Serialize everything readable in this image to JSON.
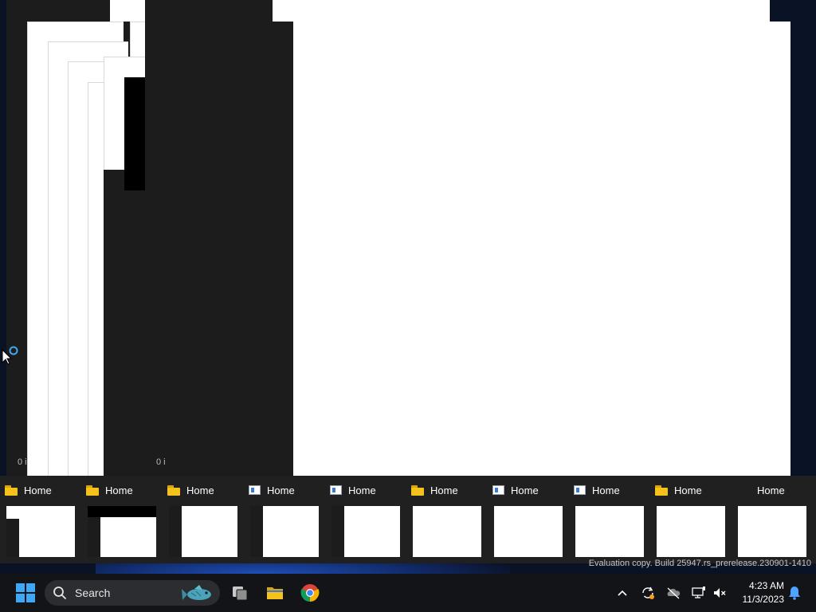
{
  "background_windows": {
    "item_count_left": "0 i",
    "item_count_right": "0 i"
  },
  "switcher": {
    "items": [
      {
        "title": "Home",
        "icon": "folder-icon"
      },
      {
        "title": "Home",
        "icon": "folder-icon"
      },
      {
        "title": "Home",
        "icon": "folder-icon"
      },
      {
        "title": "Home",
        "icon": "app-window-icon"
      },
      {
        "title": "Home",
        "icon": "app-window-icon"
      },
      {
        "title": "Home",
        "icon": "folder-icon"
      },
      {
        "title": "Home",
        "icon": "app-window-icon"
      },
      {
        "title": "Home",
        "icon": "app-window-icon"
      },
      {
        "title": "Home",
        "icon": "folder-icon"
      },
      {
        "title": "Home",
        "icon": "none"
      }
    ]
  },
  "watermark": "Evaluation copy. Build 25947.rs_prerelease.230901-1410",
  "taskbar": {
    "search_label": "Search",
    "pinned": [
      "task-view-icon",
      "file-explorer-icon",
      "chrome-icon"
    ],
    "tray_icons": [
      "chevron-up-icon",
      "sync-icon",
      "onedrive-icon",
      "network-icon",
      "volume-muted-icon"
    ],
    "time": "4:23 AM",
    "date": "11/3/2023"
  },
  "colors": {
    "accent": "#3fa8f4",
    "taskbar_bg": "#121418",
    "switcher_bg": "#202020"
  }
}
